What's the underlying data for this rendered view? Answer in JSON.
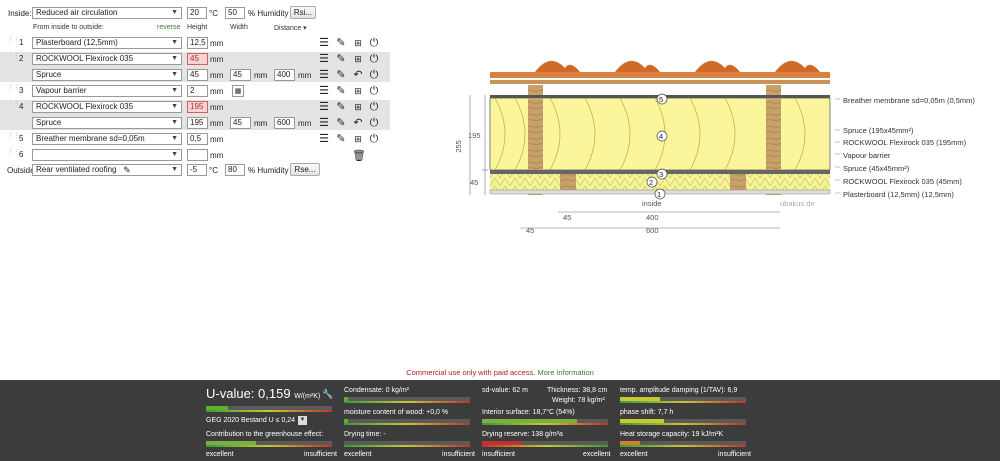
{
  "inside": {
    "label": "Inside:",
    "select": "Reduced air circulation",
    "temp": "20",
    "temp_unit": "°C",
    "hum": "50",
    "hum_unit": "% Humidity",
    "btn": "Rsi..."
  },
  "outside": {
    "label": "Outside",
    "select": "Rear ventilated roofing",
    "temp": "-5",
    "temp_unit": "°C",
    "hum": "80",
    "hum_unit": "% Humidity",
    "btn": "Rse..."
  },
  "headers": {
    "from": "From inside to outside:",
    "reverse": "reverse",
    "height": "Height",
    "width": "Width",
    "distance": "Distance ▾"
  },
  "unit_mm": "mm",
  "layers": [
    {
      "n": "1",
      "name": "Plasterboard (12,5mm)",
      "h": "12,5"
    },
    {
      "n": "2",
      "name": "ROCKWOOL Flexirock 035",
      "h": "45",
      "err": true,
      "sub": {
        "name": "Spruce",
        "h": "45",
        "w": "45",
        "d": "400"
      }
    },
    {
      "n": "3",
      "name": "Vapour barrier",
      "h": "2"
    },
    {
      "n": "4",
      "name": "ROCKWOOL Flexirock 035",
      "h": "195",
      "err": true,
      "sub": {
        "name": "Spruce",
        "h": "195",
        "w": "45",
        "d": "600"
      }
    },
    {
      "n": "5",
      "name": "Breather membrane sd=0,05m",
      "h": "0,5"
    },
    {
      "n": "6",
      "name": "",
      "h": ""
    }
  ],
  "diagram": {
    "labels": [
      "Breather membrane sd=0,05m (0,5mm)",
      "Spruce (195x45mm²)",
      "ROCKWOOL Flexirock 035 (195mm)",
      "Vapour barrier",
      "Spruce (45x45mm²)",
      "ROCKWOOL Flexirock 035 (45mm)",
      "Plasterboard (12,5mm) (12,5mm)"
    ],
    "inside": "inside",
    "brand": "ubakus.de",
    "dims": {
      "total": "255",
      "upper": "195",
      "lower": "45",
      "d45a": "45",
      "d400": "400",
      "d45b": "45",
      "d600": "600"
    },
    "markers": [
      "1",
      "2",
      "3",
      "4",
      "5"
    ]
  },
  "notice": {
    "text": "Commercial use only with paid access.",
    "link": "More information"
  },
  "results": {
    "uvalue_label": "U-value:",
    "uvalue": "0,159",
    "uvalue_unit": "W/(m²K)",
    "geg": "GEG 2020 Bestand U ≤ 0,24",
    "greenhouse": "Contribution to the greenhouse effect:",
    "excellent": "excellent",
    "insufficient": "insufficient",
    "condensate": "Condensate: 0 kg/m²",
    "moisture": "moisture content of wood: +0,0 %",
    "drying_time": "Drying time: -",
    "sd": "sd-value: 62 m",
    "thickness": "Thickness: 38,8 cm",
    "weight": "Weight: 78 kg/m²",
    "interior": "Interior surface: 18,7°C (54%)",
    "drying_reserve": "Drying reserve: 138 g/m²a",
    "amplitude": "temp. amplitude damping (1/TAV): 6,9",
    "phase": "phase shift: 7,7 h",
    "heat": "Heat storage capacity: 19 kJ/m²K"
  }
}
